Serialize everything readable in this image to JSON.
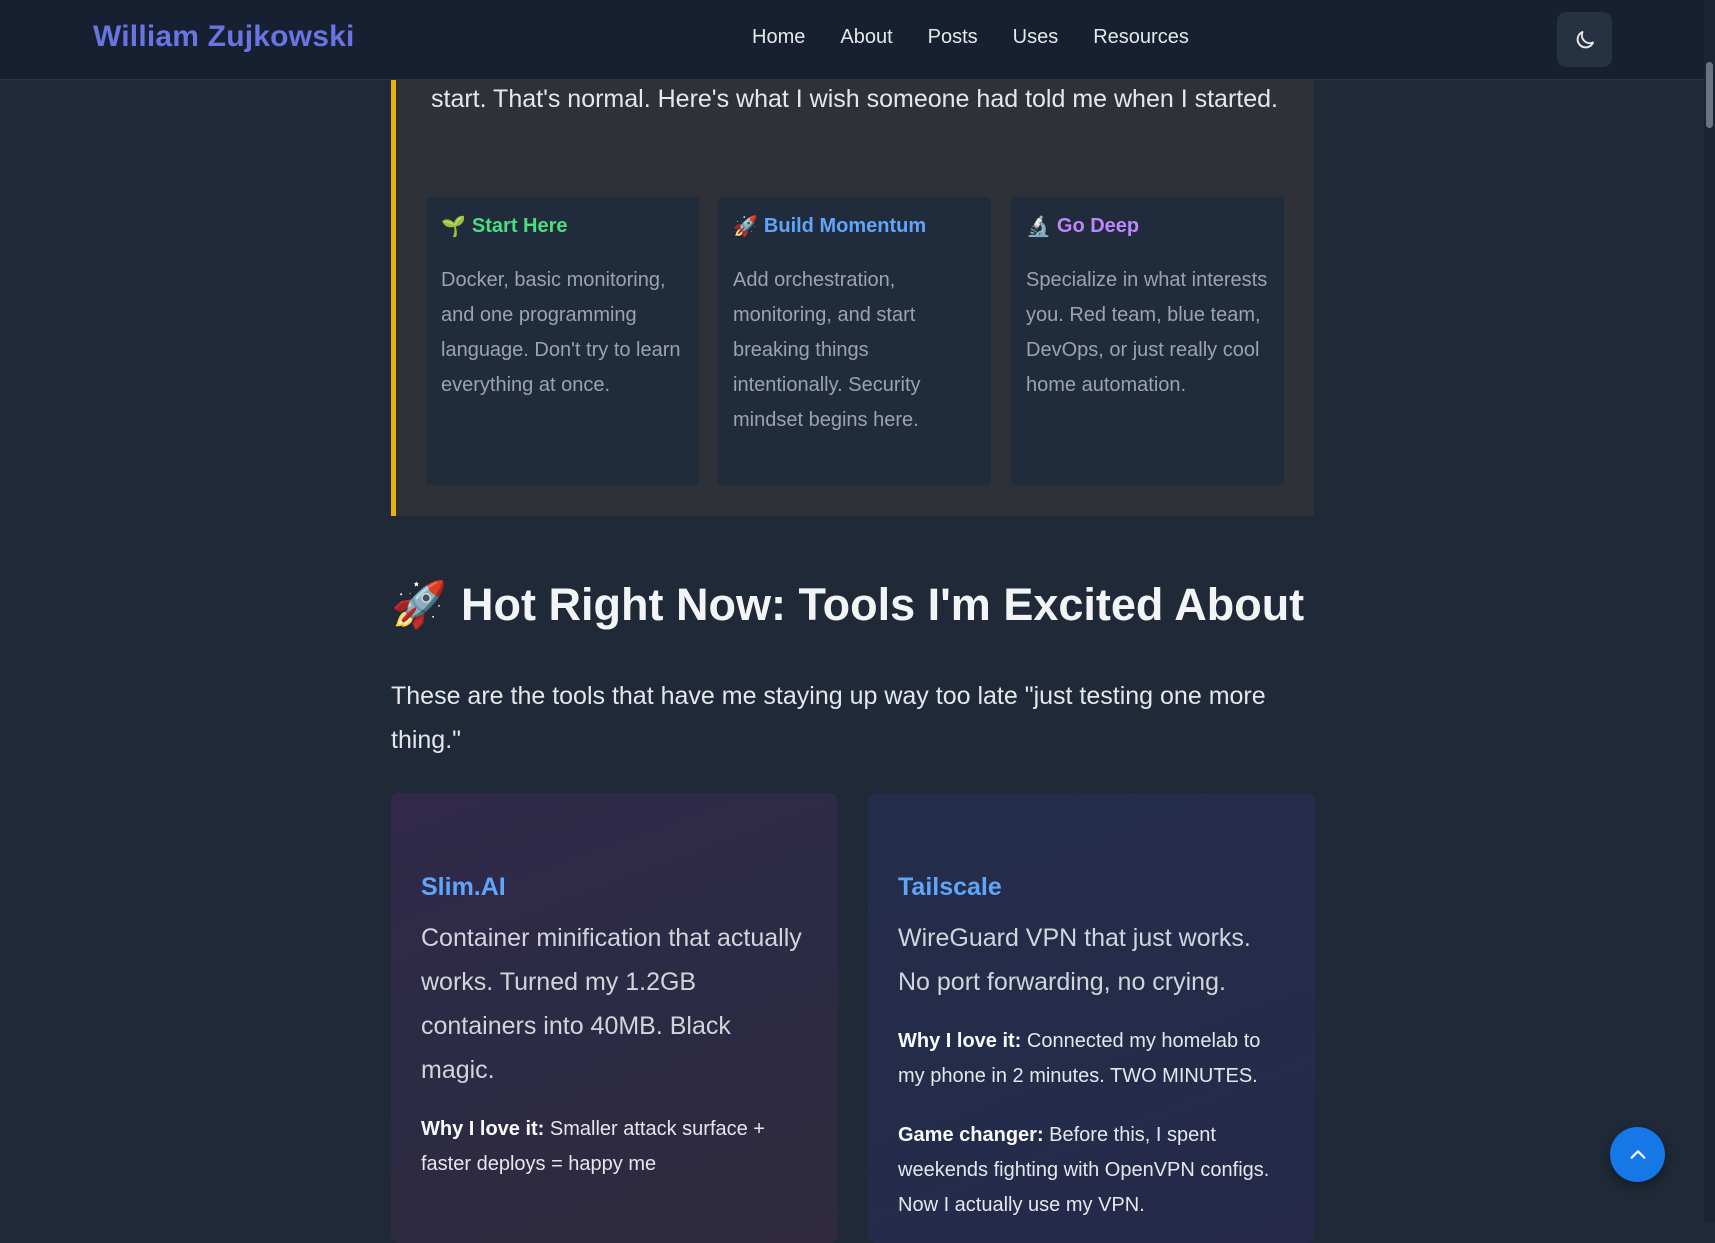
{
  "header": {
    "brand": "William Zujkowski",
    "nav": [
      "Home",
      "About",
      "Posts",
      "Uses",
      "Resources"
    ],
    "theme_toggle_icon": "moon-icon"
  },
  "callout": {
    "text": "start. That's normal. Here's what I wish someone had told me when I started.",
    "accent_color": "#eab308",
    "cards": [
      {
        "emoji": "🌱",
        "title": "Start Here",
        "title_color": "#4ade80",
        "body": "Docker, basic monitoring, and one programming language. Don't try to learn everything at once."
      },
      {
        "emoji": "🚀",
        "title": "Build Momentum",
        "title_color": "#60a5fa",
        "body": "Add orchestration, monitoring, and start breaking things intentionally. Security mindset begins here."
      },
      {
        "emoji": "🔬",
        "title": "Go Deep",
        "title_color": "#c084fc",
        "body": "Specialize in what interests you. Red team, blue team, DevOps, or just really cool home automation."
      }
    ]
  },
  "section": {
    "emoji": "🚀",
    "title": "Hot Right Now: Tools I'm Excited About",
    "intro": "These are the tools that have me staying up way too late \"just testing one more thing.\""
  },
  "tools": [
    {
      "name": "Slim.AI",
      "description": "Container minification that actually works. Turned my 1.2GB containers into 40MB. Black magic.",
      "notes": [
        {
          "label": "Why I love it:",
          "text": " Smaller attack surface + faster deploys = happy me"
        }
      ]
    },
    {
      "name": "Tailscale",
      "description": "WireGuard VPN that just works. No port forwarding, no crying.",
      "notes": [
        {
          "label": "Why I love it:",
          "text": " Connected my homelab to my phone in 2 minutes. TWO MINUTES."
        },
        {
          "label": "Game changer:",
          "text": " Before this, I spent weekends fighting with OpenVPN configs. Now I actually use my VPN."
        }
      ]
    }
  ],
  "back_to_top": {
    "icon": "chevron-up-icon",
    "color": "#1677e6"
  }
}
